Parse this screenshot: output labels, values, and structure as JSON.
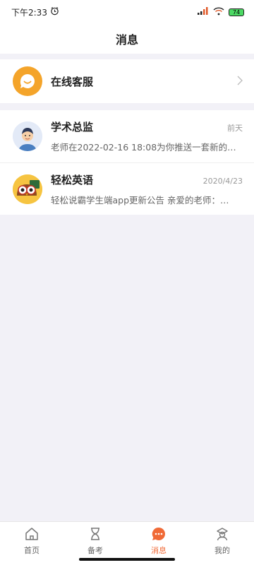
{
  "status_bar": {
    "time": "下午2:33",
    "battery": "74"
  },
  "header": {
    "title": "消息"
  },
  "service": {
    "label": "在线客服"
  },
  "messages": [
    {
      "title": "学术总监",
      "time": "前天",
      "preview": "老师在2022-02-16 18:08为你推送一套新的…"
    },
    {
      "title": "轻松英语",
      "time": "2020/4/23",
      "preview": "轻松说霸学生端app更新公告 亲爱的老师：…"
    }
  ],
  "tabs": [
    {
      "label": "首页",
      "icon": "home-icon"
    },
    {
      "label": "备考",
      "icon": "hourglass-icon"
    },
    {
      "label": "消息",
      "icon": "chat-icon"
    },
    {
      "label": "我的",
      "icon": "profile-icon"
    }
  ],
  "colors": {
    "accent": "#f06a37",
    "service_orange": "#f4a42a",
    "background": "#f2f1f7"
  }
}
